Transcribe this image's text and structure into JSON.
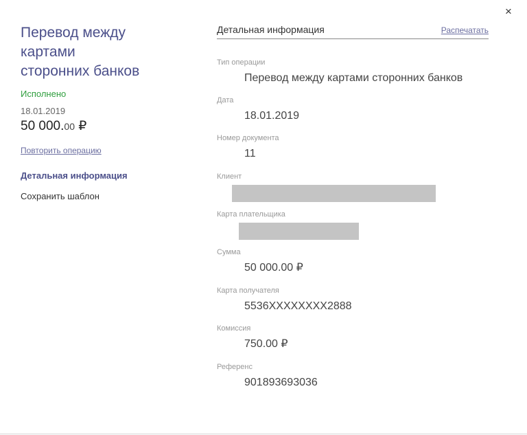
{
  "dialog": {
    "close_label": "×"
  },
  "summary": {
    "title_lines": [
      "Перевод между",
      "картами",
      "сторонних банков"
    ],
    "status": "Исполнено",
    "date": "18.01.2019",
    "amount_main": "50 000.",
    "amount_kop": "00",
    "currency": "₽",
    "repeat_link": "Повторить операцию",
    "nav": {
      "details": "Детальная информация",
      "save_template": "Сохранить шаблон"
    }
  },
  "details": {
    "title": "Детальная информация",
    "print_link": "Распечатать",
    "fields": [
      {
        "label": "Тип операции",
        "value": "Перевод между картами сторонних банков"
      },
      {
        "label": "Дата",
        "value": "18.01.2019"
      },
      {
        "label": "Номер документа",
        "value": "11"
      },
      {
        "label": "Клиент",
        "value": ""
      },
      {
        "label": "Карта плательщика",
        "value": ""
      },
      {
        "label": "Сумма",
        "value": "50 000.00 ₽"
      },
      {
        "label": "Карта получателя",
        "value": "5536XXXXXXXX2888"
      },
      {
        "label": "Комиссия",
        "value": "750.00 ₽"
      },
      {
        "label": "Референс",
        "value": "901893693036"
      }
    ]
  },
  "colors": {
    "accent": "#4b4f8a",
    "status_success": "#2f9e3e",
    "link": "#6b6ea0",
    "redaction": "#c4c4c4"
  }
}
